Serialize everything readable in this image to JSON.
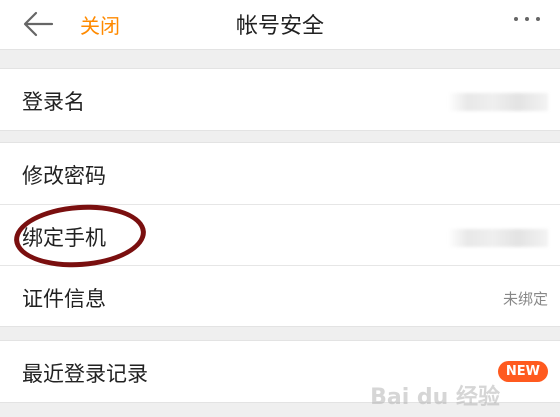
{
  "header": {
    "back_icon": "back-arrow-icon",
    "close_label": "关闭",
    "title": "帐号安全",
    "more_icon": "more-dots-icon"
  },
  "sections": [
    {
      "rows": [
        {
          "label": "登录名",
          "value": "",
          "value_obscured": true
        }
      ]
    },
    {
      "rows": [
        {
          "label": "修改密码",
          "value": ""
        },
        {
          "label": "绑定手机",
          "value": "",
          "value_obscured": true
        },
        {
          "label": "证件信息",
          "value": "未绑定"
        }
      ]
    },
    {
      "rows": [
        {
          "label": "最近登录记录",
          "badge": "NEW"
        }
      ]
    }
  ],
  "colors": {
    "accent": "#ff8a00",
    "badge": "#ff5a1f",
    "annotation": "#7a0f0f",
    "background": "#efefef"
  }
}
